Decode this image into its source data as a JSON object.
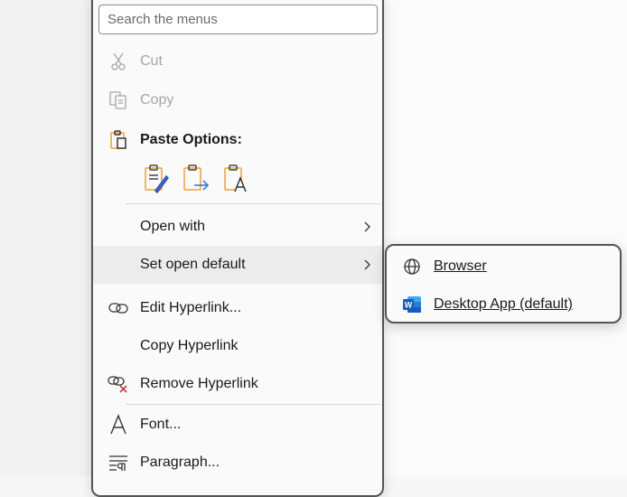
{
  "search": {
    "placeholder": "Search the menus"
  },
  "menu": {
    "cut": "Cut",
    "copy": "Copy",
    "paste_options": "Paste Options:",
    "paste_icons": [
      "paste-keep-source-formatting-icon",
      "paste-merge-formatting-icon",
      "paste-keep-text-only-icon"
    ],
    "open_with": "Open with",
    "set_open_default": "Set open default",
    "edit_hyperlink": "Edit Hyperlink...",
    "copy_hyperlink": "Copy Hyperlink",
    "remove_hyperlink": "Remove Hyperlink",
    "font": "Font...",
    "paragraph": "Paragraph..."
  },
  "submenu": {
    "browser": "Browser",
    "desktop_app": "Desktop App (default)"
  },
  "colors": {
    "border": "#555555",
    "accent_orange": "#e8a33a",
    "word_blue": "#185abd",
    "disabled": "#a6a6a6"
  }
}
